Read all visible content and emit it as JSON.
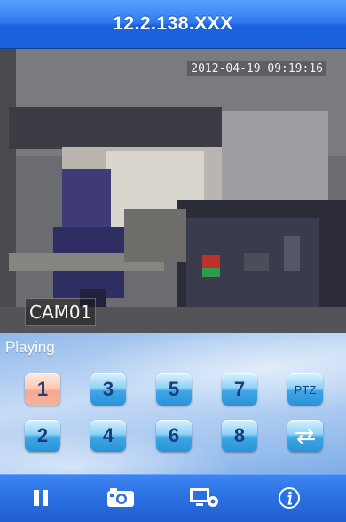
{
  "title": "12.2.138.XXX",
  "video": {
    "timestamp": "2012-04-19 09:19:16",
    "camera_label": "CAM01"
  },
  "status": "Playing",
  "channels": {
    "row1": [
      "1",
      "3",
      "5",
      "7",
      "PTZ"
    ],
    "row2": [
      "2",
      "4",
      "6",
      "8"
    ],
    "active": "1"
  },
  "toolbar": {
    "icons": [
      "pause-icon",
      "snapshot-camera-icon",
      "settings-monitor-icon",
      "info-icon"
    ]
  },
  "colors": {
    "title_bar": "#2e78f0",
    "button": "#3ea6e6",
    "active_button": "#f6a98d"
  }
}
